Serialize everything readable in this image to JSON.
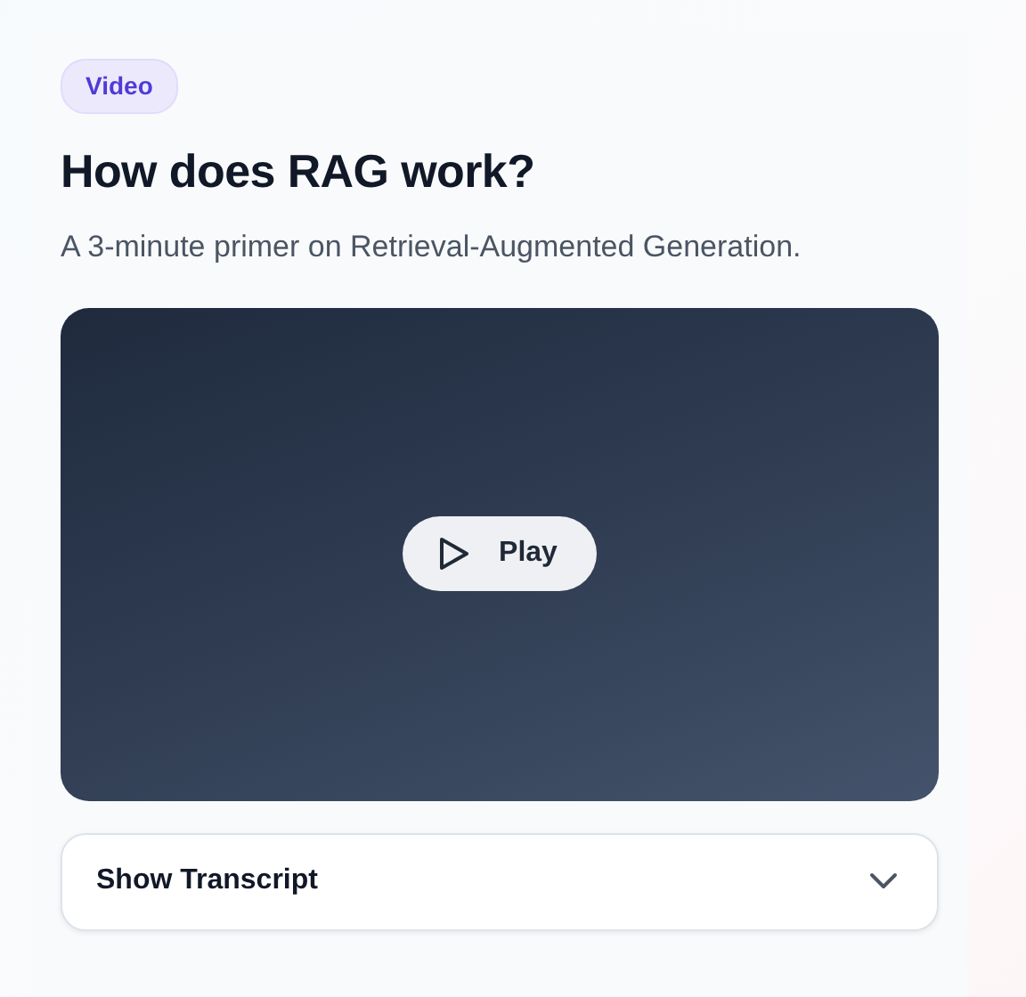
{
  "badge": "Video",
  "title": "How does RAG work?",
  "subtitle": "A 3-minute primer on Retrieval-Augmented Generation.",
  "video": {
    "play_label": "Play"
  },
  "transcript": {
    "label": "Show Transcript",
    "expanded": false
  }
}
